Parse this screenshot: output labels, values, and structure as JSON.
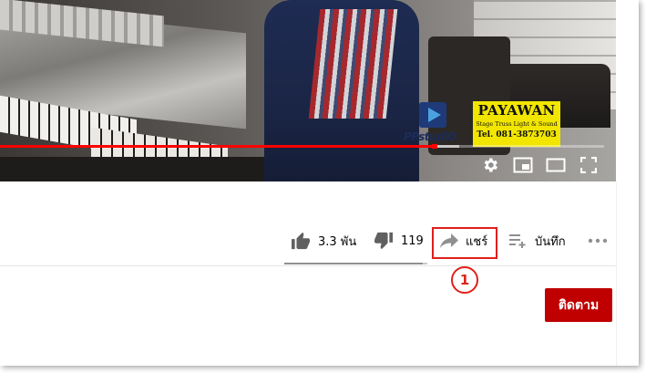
{
  "video": {
    "watermark": {
      "studio_logo_text": "PPstudiO",
      "brand_name": "PAYAWAN",
      "brand_tagline": "Stage Truss Light & Sound",
      "brand_phone": "Tel. 081-3873703"
    },
    "progress": {
      "played_fraction": 0.72,
      "buffered_fraction": 0.04
    },
    "controls": [
      "gear-icon",
      "miniplayer-icon",
      "theater-mode-icon",
      "fullscreen-icon"
    ]
  },
  "actions": {
    "like": {
      "icon": "thumbs-up-icon",
      "label": "3.3 พัน"
    },
    "dislike": {
      "icon": "thumbs-down-icon",
      "label": "119"
    },
    "share": {
      "icon": "share-arrow-icon",
      "label": "แชร์"
    },
    "save": {
      "icon": "playlist-add-icon",
      "label": "บันทึก"
    },
    "more": {
      "icon": "more-horizontal-icon"
    },
    "sentiment_like_fraction": 0.97
  },
  "annotation": {
    "callout_number": "1",
    "color": "#e0201b"
  },
  "subscribe": {
    "label": "ติดตาม",
    "color": "#c00000"
  }
}
